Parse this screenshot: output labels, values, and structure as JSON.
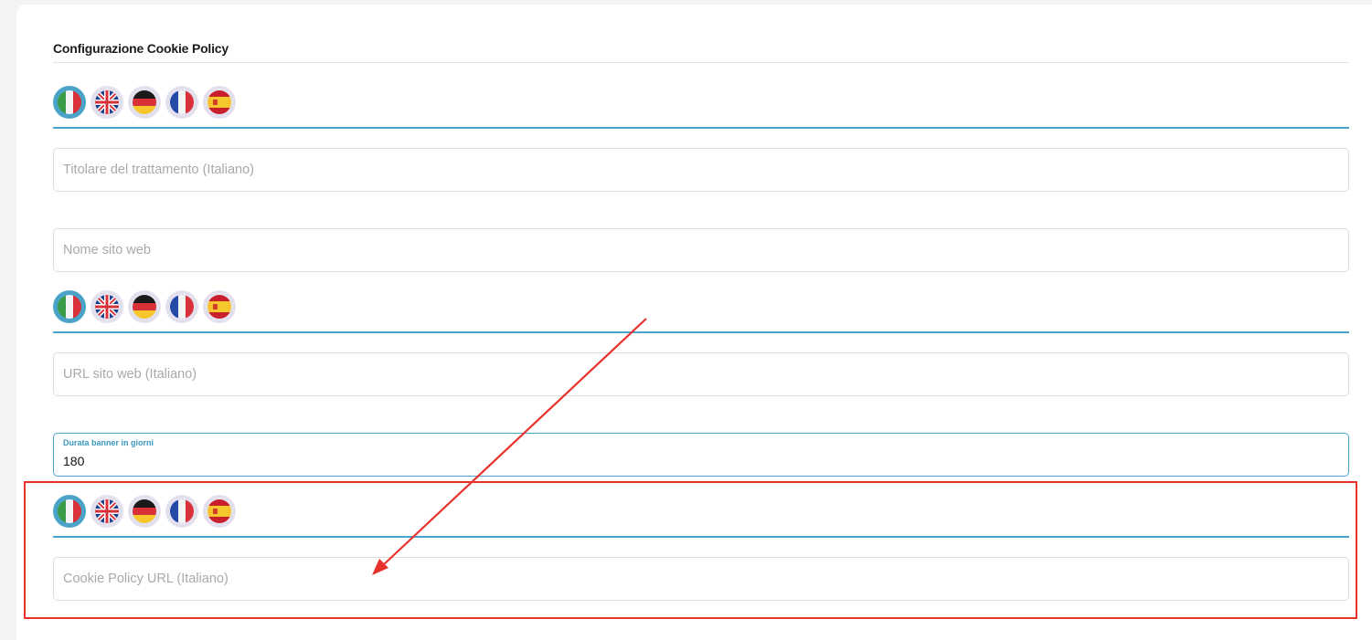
{
  "section": {
    "title": "Configurazione Cookie Policy"
  },
  "languages": [
    "Italiano",
    "English",
    "Deutsch",
    "Français",
    "Español"
  ],
  "fields": {
    "titolare": {
      "placeholder": "Titolare del trattamento (Italiano)",
      "value": ""
    },
    "nome_sito": {
      "placeholder": "Nome sito web",
      "value": ""
    },
    "url_sito": {
      "placeholder": "URL sito web (Italiano)",
      "value": ""
    },
    "durata": {
      "label": "Durata banner in giorni",
      "value": "180"
    },
    "cookie_url": {
      "placeholder": "Cookie Policy URL (Italiano)",
      "value": ""
    }
  },
  "colors": {
    "accent": "#4aa3c8",
    "annotation": "#e8312a"
  }
}
